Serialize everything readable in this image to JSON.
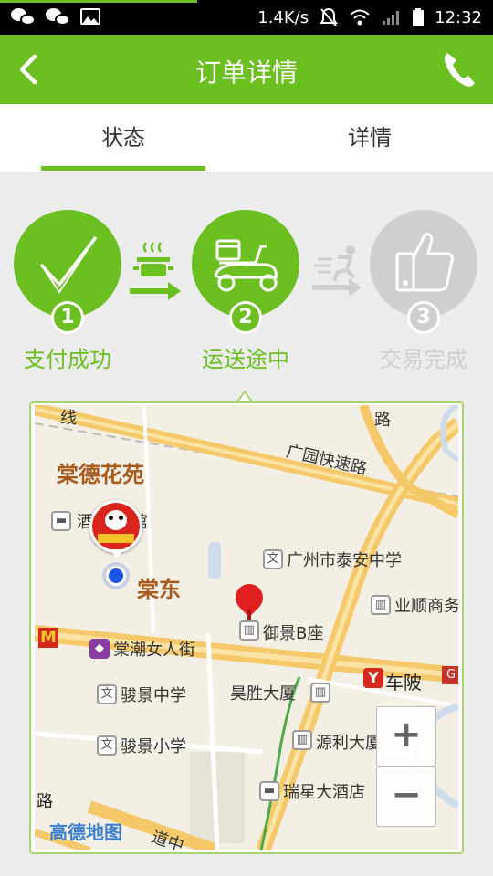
{
  "status_bar": {
    "speed": "1.4K/s",
    "time": "12:32",
    "icons": [
      "wechat-icon",
      "wechat-icon",
      "image-icon",
      "mute-icon",
      "wifi-icon",
      "signal-icon",
      "battery-icon"
    ]
  },
  "app_bar": {
    "title": "订单详情",
    "back_icon": "back-arrow-icon",
    "call_icon": "phone-icon"
  },
  "tabs": [
    {
      "label": "状态",
      "active": true
    },
    {
      "label": "详情",
      "active": false
    }
  ],
  "steps": [
    {
      "number": "1",
      "label": "支付成功",
      "icon": "checkmark-icon",
      "state": "done"
    },
    {
      "number": "2",
      "label": "运送途中",
      "icon": "delivery-scooter-icon",
      "state": "current"
    },
    {
      "number": "3",
      "label": "交易完成",
      "icon": "thumbs-up-icon",
      "state": "pending"
    }
  ],
  "colors": {
    "accent": "#6bbf21",
    "pending": "#cfcfcf",
    "map_road": "#f5c969",
    "location_blue": "#1a56e8"
  },
  "map": {
    "labels": {
      "area_big_1": "棠德花苑",
      "area_big_2": "棠东",
      "road_1": "广园快速路",
      "road_top": "路",
      "road_left_top": "线",
      "hotel_1": "酒   务宾馆",
      "school_1": "广州市泰安中学",
      "building_1": "御景B座",
      "business_1": "业顺商务",
      "shopping": "棠潮女人街",
      "school_2": "骏景中学",
      "building_2": "昊胜大厦",
      "metro": "车陂",
      "school_3": "骏景小学",
      "building_3": "源利大厦",
      "hotel_2": "瑞星大酒店",
      "road_bottom_left": "路",
      "road_bottom": "道中",
      "brand": "高德地图"
    },
    "zoom_in": "+",
    "zoom_out": "−"
  }
}
